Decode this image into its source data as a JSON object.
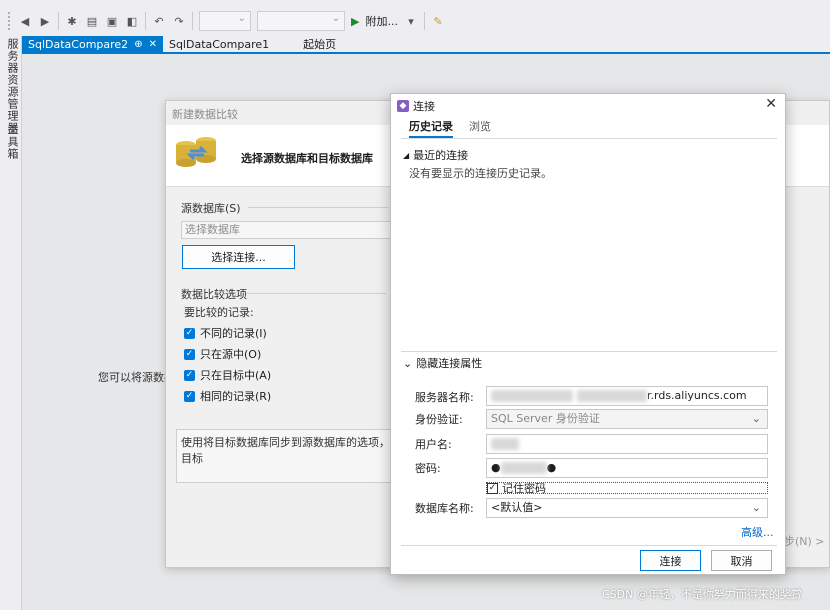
{
  "toolbar": {
    "attach_label": "附加..."
  },
  "sidebar": {
    "server_explorer": "服务器资源管理器",
    "toolbox": "工具箱"
  },
  "tabs": [
    {
      "label": "SqlDataCompare2",
      "active": true
    },
    {
      "label": "SqlDataCompare1",
      "active": false
    },
    {
      "label": "起始页",
      "active": false
    }
  ],
  "wizard": {
    "title": "新建数据比较",
    "header": "选择源数据库和目标数据库",
    "source_label": "源数据库(S)",
    "source_placeholder": "选择数据库",
    "select_connection_button": "选择连接...",
    "options_label": "数据比较选项",
    "records_label": "要比较的记录:",
    "checkboxes": [
      {
        "label": "不同的记录(I)",
        "checked": true
      },
      {
        "label": "只在源中(O)",
        "checked": true
      },
      {
        "label": "只在目标中(A)",
        "checked": true
      },
      {
        "label": "相同的记录(R)",
        "checked": true
      }
    ],
    "description": "使用将目标数据库同步到源数据库的选项，将目标",
    "next_button": "步(N) >"
  },
  "hint": "您可以将源数据",
  "connection": {
    "title": "连接",
    "tabs": [
      "历史记录",
      "浏览"
    ],
    "recent_header": "最近的连接",
    "empty_message": "没有要显示的连接历史记录。",
    "hide_props_header": "隐藏连接属性",
    "labels": {
      "server": "服务器名称:",
      "auth": "身份验证:",
      "user": "用户名:",
      "password": "密码:",
      "database": "数据库名称:"
    },
    "values": {
      "server_suffix": "r.rds.aliyuncs.com",
      "auth": "SQL Server 身份验证",
      "password": "●",
      "database": "<默认值>"
    },
    "remember_password": "记住密码",
    "advanced_link": "高级...",
    "connect_button": "连接",
    "cancel_button": "取消"
  },
  "watermark": "CSDN @年轻，不是你努力而得来的奖赏",
  "colors": {
    "accent": "#007acc",
    "checkbox": "#0078d7",
    "link": "#0066cc"
  }
}
